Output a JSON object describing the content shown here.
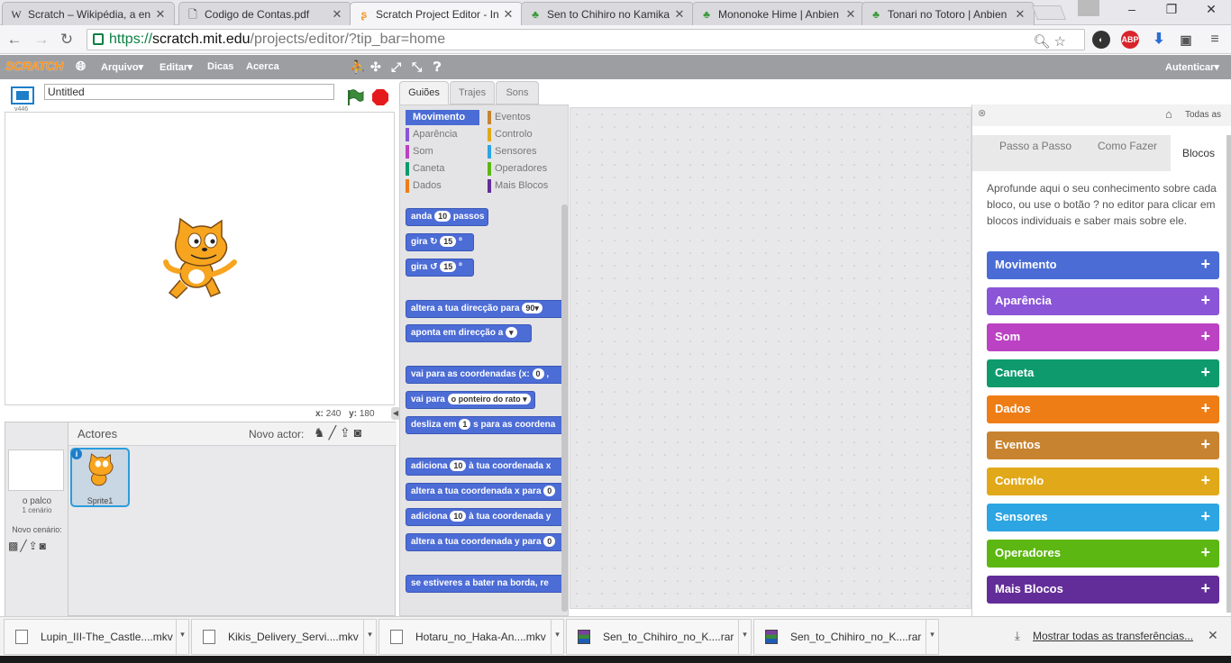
{
  "browser": {
    "tabs": [
      {
        "title": "Scratch – Wikipédia, a en",
        "favicon": "W",
        "active": false
      },
      {
        "title": "Codigo de Contas.pdf",
        "favicon": "doc",
        "active": false
      },
      {
        "title": "Scratch Project Editor - In",
        "favicon": "scratch",
        "active": true
      },
      {
        "title": "Sen to Chihiro no Kamika",
        "favicon": "clover",
        "active": false
      },
      {
        "title": "Mononoke Hime | Anbien",
        "favicon": "clover",
        "active": false
      },
      {
        "title": "Tonari no Totoro | Anbien",
        "favicon": "clover",
        "active": false
      }
    ],
    "url_scheme": "https://",
    "url_host": "scratch.mit.edu",
    "url_path": "/projects/editor/?tip_bar=home",
    "window_controls": [
      "–",
      "❐",
      "✕"
    ]
  },
  "menubar": {
    "logo": "SCRATCH",
    "items": [
      "Arquivo▾",
      "Editar▾",
      "Dicas",
      "Acerca"
    ],
    "signin": "Autenticar▾"
  },
  "stage": {
    "project_title": "Untitled",
    "version": "v446",
    "x_label": "x:",
    "x_value": "240",
    "y_label": "y:",
    "y_value": "180"
  },
  "sprites": {
    "header": "Actores",
    "new_actor": "Novo actor:",
    "stage_label": "o palco",
    "stage_backdrops": "1 cenário",
    "new_backdrop": "Novo cenário:",
    "sprite_name": "Sprite1"
  },
  "editor_tabs": [
    "Guiões",
    "Trajes",
    "Sons"
  ],
  "categories": [
    {
      "name": "Movimento",
      "color": "#4a6cd4",
      "selected": true
    },
    {
      "name": "Eventos",
      "color": "#c88330",
      "selected": false
    },
    {
      "name": "Aparência",
      "color": "#8a55d7",
      "selected": false
    },
    {
      "name": "Controlo",
      "color": "#e1a91a",
      "selected": false
    },
    {
      "name": "Som",
      "color": "#bb42c3",
      "selected": false
    },
    {
      "name": "Sensores",
      "color": "#2ca5e2",
      "selected": false
    },
    {
      "name": "Caneta",
      "color": "#0e9a6c",
      "selected": false
    },
    {
      "name": "Operadores",
      "color": "#5cb712",
      "selected": false
    },
    {
      "name": "Dados",
      "color": "#ee7d16",
      "selected": false
    },
    {
      "name": "Mais Blocos",
      "color": "#632d99",
      "selected": false
    }
  ],
  "blocks": [
    {
      "pre": "anda",
      "num": "10",
      "post": "passos"
    },
    {
      "pre": "gira ↻",
      "num": "15",
      "post": "º"
    },
    {
      "pre": "gira ↺",
      "num": "15",
      "post": "º"
    },
    {
      "pre": "altera a tua direcção para",
      "num": "90▾",
      "post": ""
    },
    {
      "pre": "aponta em direcção a",
      "num": "▾",
      "post": ""
    },
    {
      "pre": "vai para as coordenadas (x:",
      "num": "0",
      "post": ","
    },
    {
      "pre": "vai para",
      "num": "o ponteiro do rato ▾",
      "post": ""
    },
    {
      "pre": "desliza em",
      "num": "1",
      "post": "s para as coordena"
    },
    {
      "pre": "adiciona",
      "num": "10",
      "post": "à tua coordenada x"
    },
    {
      "pre": "altera a tua coordenada x para",
      "num": "0",
      "post": ""
    },
    {
      "pre": "adiciona",
      "num": "10",
      "post": "à tua coordenada y"
    },
    {
      "pre": "altera a tua coordenada y para",
      "num": "0",
      "post": ""
    },
    {
      "pre": "se estiveres a bater na borda, re",
      "num": "",
      "post": ""
    }
  ],
  "help": {
    "all_label": "Todas as",
    "tabs": [
      "Passo a Passo",
      "Como Fazer",
      "Blocos"
    ],
    "text": "Aprofunde aqui o seu conhecimento sobre cada bloco, ou use o botão ? no editor para clicar em blocos individuais e saber mais sobre ele.",
    "categories": [
      {
        "name": "Movimento",
        "color": "#4a6cd4"
      },
      {
        "name": "Aparência",
        "color": "#8a55d7"
      },
      {
        "name": "Som",
        "color": "#bb42c3"
      },
      {
        "name": "Caneta",
        "color": "#0e9a6c"
      },
      {
        "name": "Dados",
        "color": "#ee7d16"
      },
      {
        "name": "Eventos",
        "color": "#c88330"
      },
      {
        "name": "Controlo",
        "color": "#e1a91a"
      },
      {
        "name": "Sensores",
        "color": "#2ca5e2"
      },
      {
        "name": "Operadores",
        "color": "#5cb712"
      },
      {
        "name": "Mais Blocos",
        "color": "#632d99"
      }
    ]
  },
  "downloads": {
    "items": [
      {
        "name": "Lupin_III-The_Castle....mkv",
        "type": "file"
      },
      {
        "name": "Kikis_Delivery_Servi....mkv",
        "type": "file"
      },
      {
        "name": "Hotaru_no_Haka-An....mkv",
        "type": "file"
      },
      {
        "name": "Sen_to_Chihiro_no_K....rar",
        "type": "rar"
      },
      {
        "name": "Sen_to_Chihiro_no_K....rar",
        "type": "rar"
      }
    ],
    "show_all": "Mostrar todas as transferências..."
  }
}
